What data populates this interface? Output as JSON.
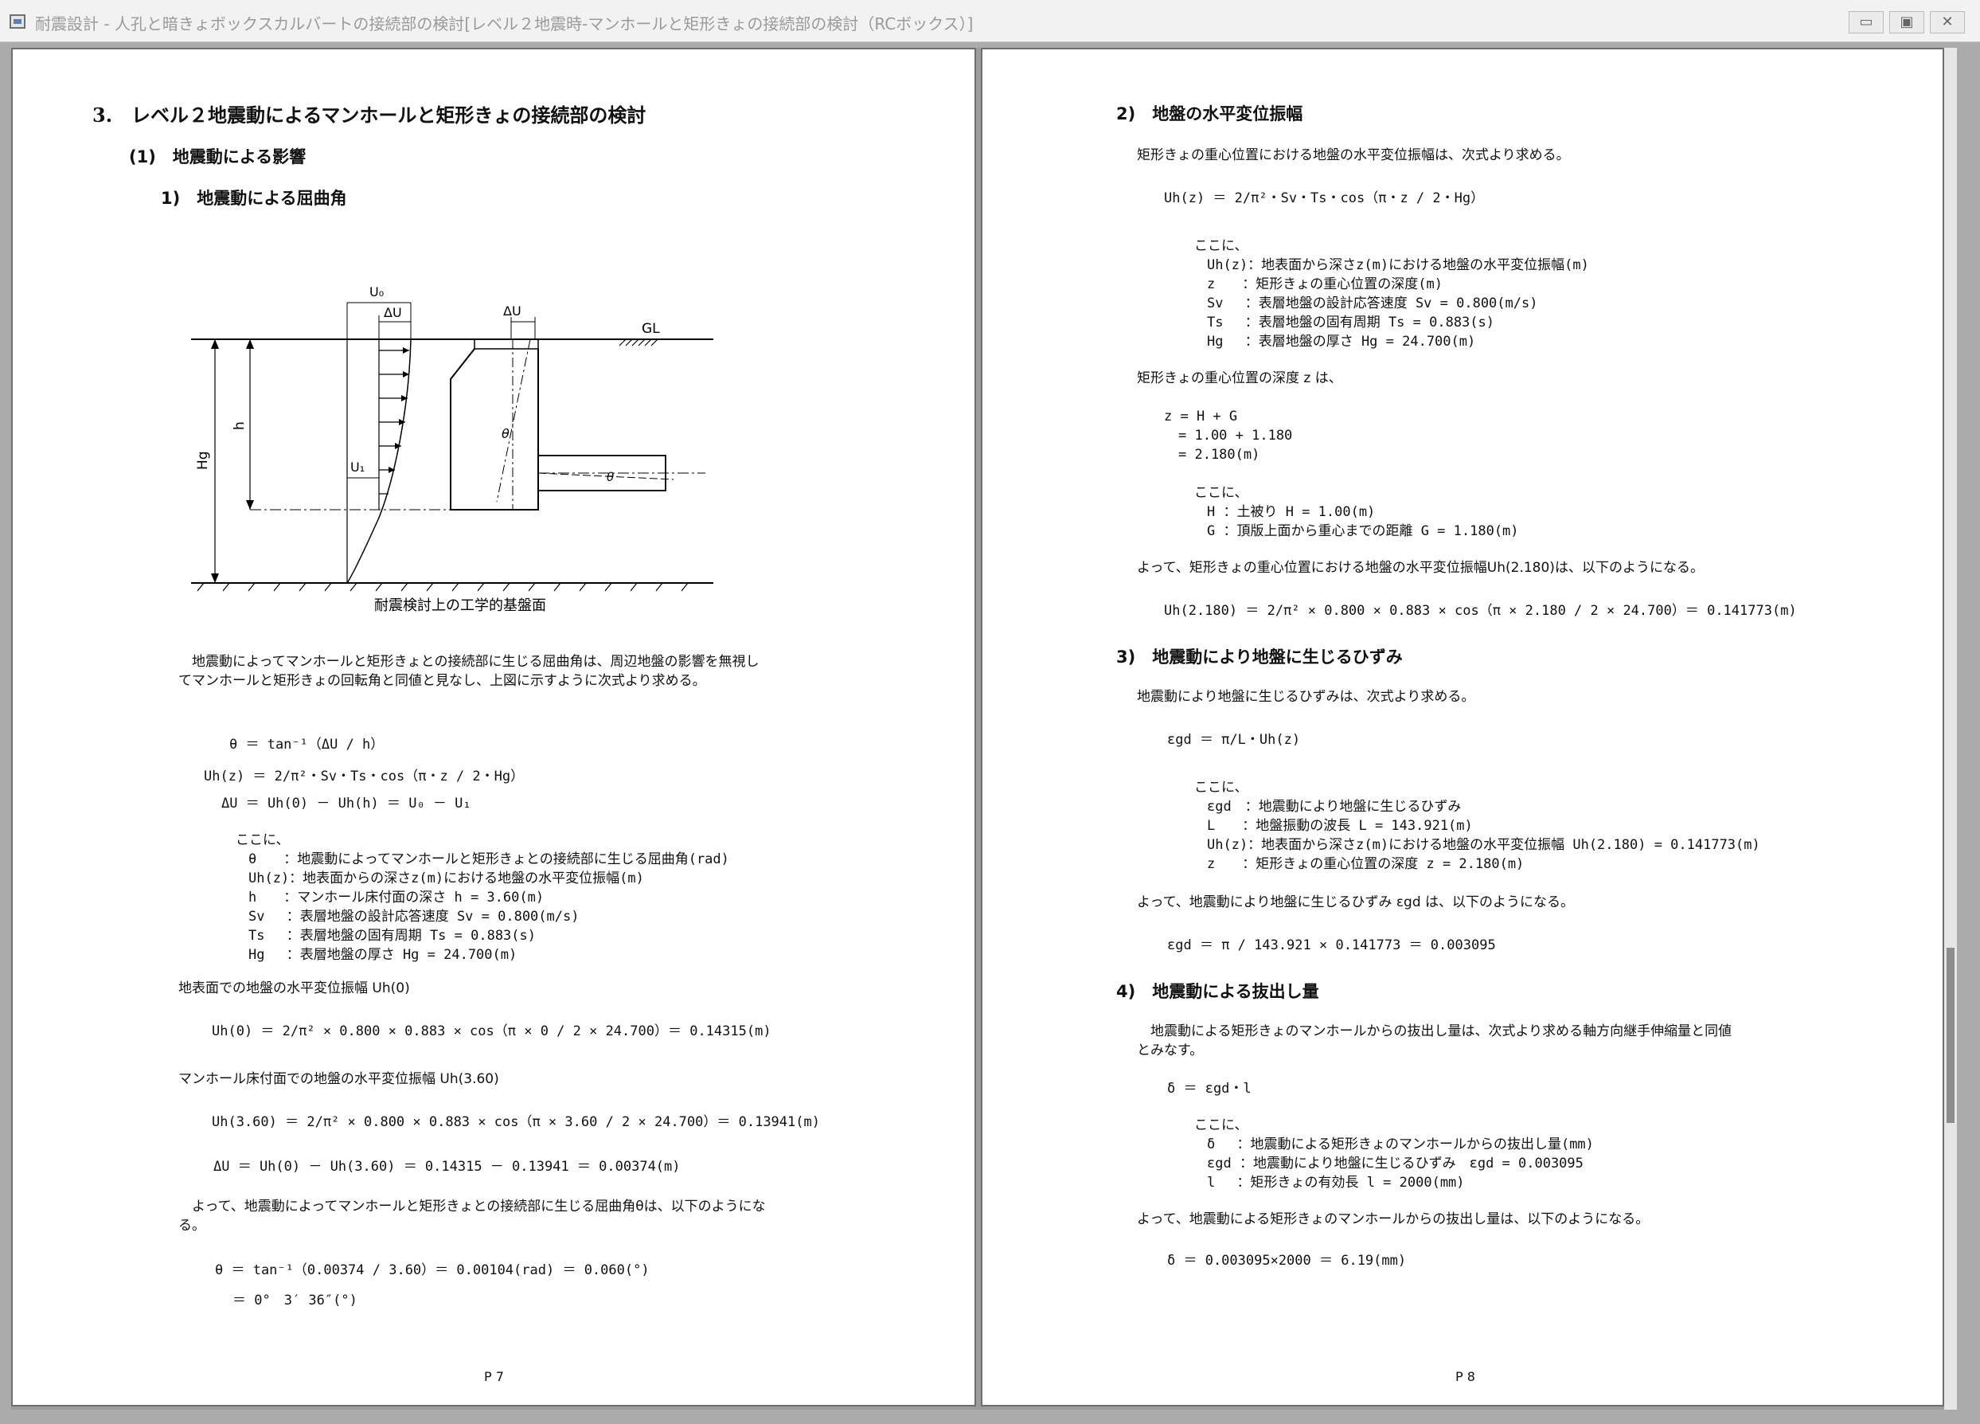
{
  "window": {
    "title": "耐震設計 - 人孔と暗きょボックスカルバートの接続部の検討[レベル２地震時-マンホールと矩形きょの接続部の検討（RCボックス）]",
    "minimize_glyph": "▭",
    "maximize_glyph": "▣",
    "close_glyph": "✕"
  },
  "page7": {
    "heading": "3.　レベル２地震動によるマンホールと矩形きょの接続部の検討",
    "sub1": "(1)　地震動による影響",
    "sub1a": "1)　地震動による屈曲角",
    "diagram": {
      "u0": "U₀",
      "du_left": "ΔU",
      "du_right": "ΔU",
      "gl": "GL",
      "h": "h",
      "hg": "Hg",
      "u1": "U₁",
      "theta1": "θ",
      "theta2": "θ",
      "base_caption": "耐震検討上の工学的基盤面"
    },
    "para1_line1": "　地震動によってマンホールと矩形きょとの接続部に生じる屈曲角は、周辺地盤の影響を無視し",
    "para1_line2": "てマンホールと矩形きょの回転角と同値と見なし、上図に示すように次式より求める。",
    "eq_theta": "θ ＝ tan⁻¹（ΔU / h）",
    "eq_uh": "Uh(z) ＝ 2/π²・Sv・Ts・cos（π・z / 2・Hg）",
    "eq_du": "ΔU ＝ Uh(0) － Uh(h) ＝ U₀ － U₁",
    "where": "ここに、",
    "defs": [
      "θ　　：地震動によってマンホールと矩形きょとの接続部に生じる屈曲角(rad)",
      "Uh(z)：地表面からの深さz(m)における地盤の水平変位振幅(m)",
      "h　　：マンホール床付面の深さ h = 3.60(m)",
      "Sv　 ：表層地盤の設計応答速度 Sv = 0.800(m/s)",
      "Ts　 ：表層地盤の固有周期 Ts = 0.883(s)",
      "Hg　 ：表層地盤の厚さ Hg = 24.700(m)"
    ],
    "label_uh0": "地表面での地盤の水平変位振幅 Uh(0)",
    "eq_uh0": "Uh(0) ＝ 2/π² × 0.800 × 0.883 × cos（π × 0 / 2 × 24.700）＝ 0.14315(m)",
    "label_uh360": "マンホール床付面での地盤の水平変位振幅 Uh(3.60)",
    "eq_uh360": "Uh(3.60) ＝ 2/π² × 0.800 × 0.883 × cos（π × 3.60 / 2 × 24.700）＝ 0.13941(m)",
    "eq_du_val": "ΔU ＝ Uh(0) － Uh(3.60) ＝ 0.14315 － 0.13941 ＝ 0.00374(m)",
    "para2_line1": "　よって、地震動によってマンホールと矩形きょとの接続部に生じる屈曲角θは、以下のようにな",
    "para2_line2": "る。",
    "eq_theta_val": "θ ＝ tan⁻¹（0.00374 / 3.60）＝ 0.00104(rad) ＝ 0.060(°)",
    "eq_theta_deg": "＝ 0°　3′ 36″(°)",
    "page_no": "P 7"
  },
  "page8": {
    "s2_title": "2)　地盤の水平変位振幅",
    "s2_intro": "矩形きょの重心位置における地盤の水平変位振幅は、次式より求める。",
    "s2_eq": "Uh(z) ＝ 2/π²・Sv・Ts・cos（π・z / 2・Hg）",
    "where": "ここに、",
    "s2_defs": [
      "Uh(z)：地表面から深さz(m)における地盤の水平変位振幅(m)",
      "z　　：矩形きょの重心位置の深度(m)",
      "Sv　 ：表層地盤の設計応答速度 Sv = 0.800(m/s)",
      "Ts　 ：表層地盤の固有周期 Ts = 0.883(s)",
      "Hg　 ：表層地盤の厚さ Hg = 24.700(m)"
    ],
    "z_intro": "矩形きょの重心位置の深度 z は、",
    "z_eq1": "z = H + G",
    "z_eq2": "= 1.00 + 1.180",
    "z_eq3": "= 2.180(m)",
    "z_defs": [
      "H ：土被り H = 1.00(m)",
      "G ：頂版上面から重心までの距離 G = 1.180(m)"
    ],
    "s2_result_text": "よって、矩形きょの重心位置における地盤の水平変位振幅Uh(2.180)は、以下のようになる。",
    "s2_result_eq": "Uh(2.180) ＝ 2/π² × 0.800 × 0.883 × cos（π × 2.180 / 2 × 24.700）＝ 0.141773(m)",
    "s3_title": "3)　地震動により地盤に生じるひずみ",
    "s3_intro": "地震動により地盤に生じるひずみは、次式より求める。",
    "s3_eq": "εgd ＝ π/L・Uh(z)",
    "s3_defs": [
      "εgd　：地震動により地盤に生じるひずみ",
      "L　　：地盤振動の波長 L = 143.921(m)",
      "Uh(z)：地表面から深さz(m)における地盤の水平変位振幅 Uh(2.180) = 0.141773(m)",
      "z　　：矩形きょの重心位置の深度 z = 2.180(m)"
    ],
    "s3_result_text": "よって、地震動により地盤に生じるひずみ εgd は、以下のようになる。",
    "s3_result_eq": "εgd ＝ π / 143.921 × 0.141773 ＝ 0.003095",
    "s4_title": "4)　地震動による抜出し量",
    "s4_p_line1": "　地震動による矩形きょのマンホールからの抜出し量は、次式より求める軸方向継手伸縮量と同値",
    "s4_p_line2": "とみなす。",
    "s4_eq": "δ ＝ εgd・l",
    "s4_defs": [
      "δ　 ：地震動による矩形きょのマンホールからの抜出し量(mm)",
      "εgd ：地震動により地盤に生じるひずみ　εgd = 0.003095",
      "l　 ：矩形きょの有効長 l = 2000(mm)"
    ],
    "s4_result_text": "よって、地震動による矩形きょのマンホールからの抜出し量は、以下のようになる。",
    "s4_result_eq": "δ ＝ 0.003095×2000 ＝ 6.19(mm)",
    "page_no": "P 8"
  }
}
